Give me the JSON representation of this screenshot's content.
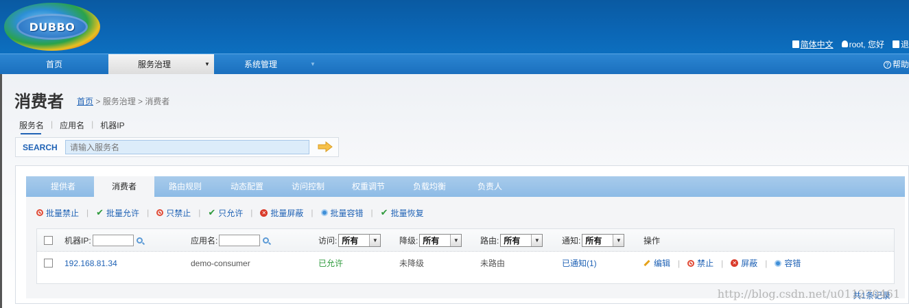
{
  "header": {
    "logo_text": "DUBBO",
    "lang_link": "简体中文",
    "user": "root, 您好",
    "logout": "退"
  },
  "nav": {
    "items": [
      {
        "label": "首页"
      },
      {
        "label": "服务治理"
      },
      {
        "label": "系统管理"
      }
    ],
    "help": "帮助"
  },
  "page": {
    "title": "消费者",
    "breadcrumb": {
      "home": "首页",
      "rest": " > 服务治理 > 消费者"
    }
  },
  "mode_tabs": [
    "服务名",
    "应用名",
    "机器IP"
  ],
  "search": {
    "label": "SEARCH",
    "placeholder": "请输入服务名"
  },
  "panel_tabs": [
    "提供者",
    "消费者",
    "路由规则",
    "动态配置",
    "访问控制",
    "权重调节",
    "负载均衡",
    "负责人"
  ],
  "actions": [
    {
      "icon": "ban-icon",
      "label": "批量禁止"
    },
    {
      "icon": "check-icon",
      "label": "批量允许"
    },
    {
      "icon": "ban-icon",
      "label": "只禁止"
    },
    {
      "icon": "check-icon",
      "label": "只允许"
    },
    {
      "icon": "block-icon",
      "label": "批量屏蔽"
    },
    {
      "icon": "tolerance-icon",
      "label": "批量容错"
    },
    {
      "icon": "check-icon",
      "label": "批量恢复"
    }
  ],
  "table": {
    "head": {
      "ip_label": "机器IP:",
      "app_label": "应用名:",
      "access_label": "访问:",
      "access_value": "所有",
      "degrade_label": "降级:",
      "degrade_value": "所有",
      "route_label": "路由:",
      "route_value": "所有",
      "notify_label": "通知:",
      "notify_value": "所有",
      "ops_label": "操作"
    },
    "rows": [
      {
        "ip": "192.168.81.34",
        "app": "demo-consumer",
        "access": "已允许",
        "degrade": "未降级",
        "route": "未路由",
        "notify": "已通知(1)",
        "ops": [
          "编辑",
          "禁止",
          "屏蔽",
          "容错"
        ]
      }
    ],
    "total": "共1条记录"
  },
  "watermark": "http://blog.csdn.net/u011270461",
  "colors": {
    "header": "#0b66b5",
    "link": "#1f62b5",
    "tab_bar": "#8dbbe6",
    "allowed": "#2e9a3c"
  }
}
